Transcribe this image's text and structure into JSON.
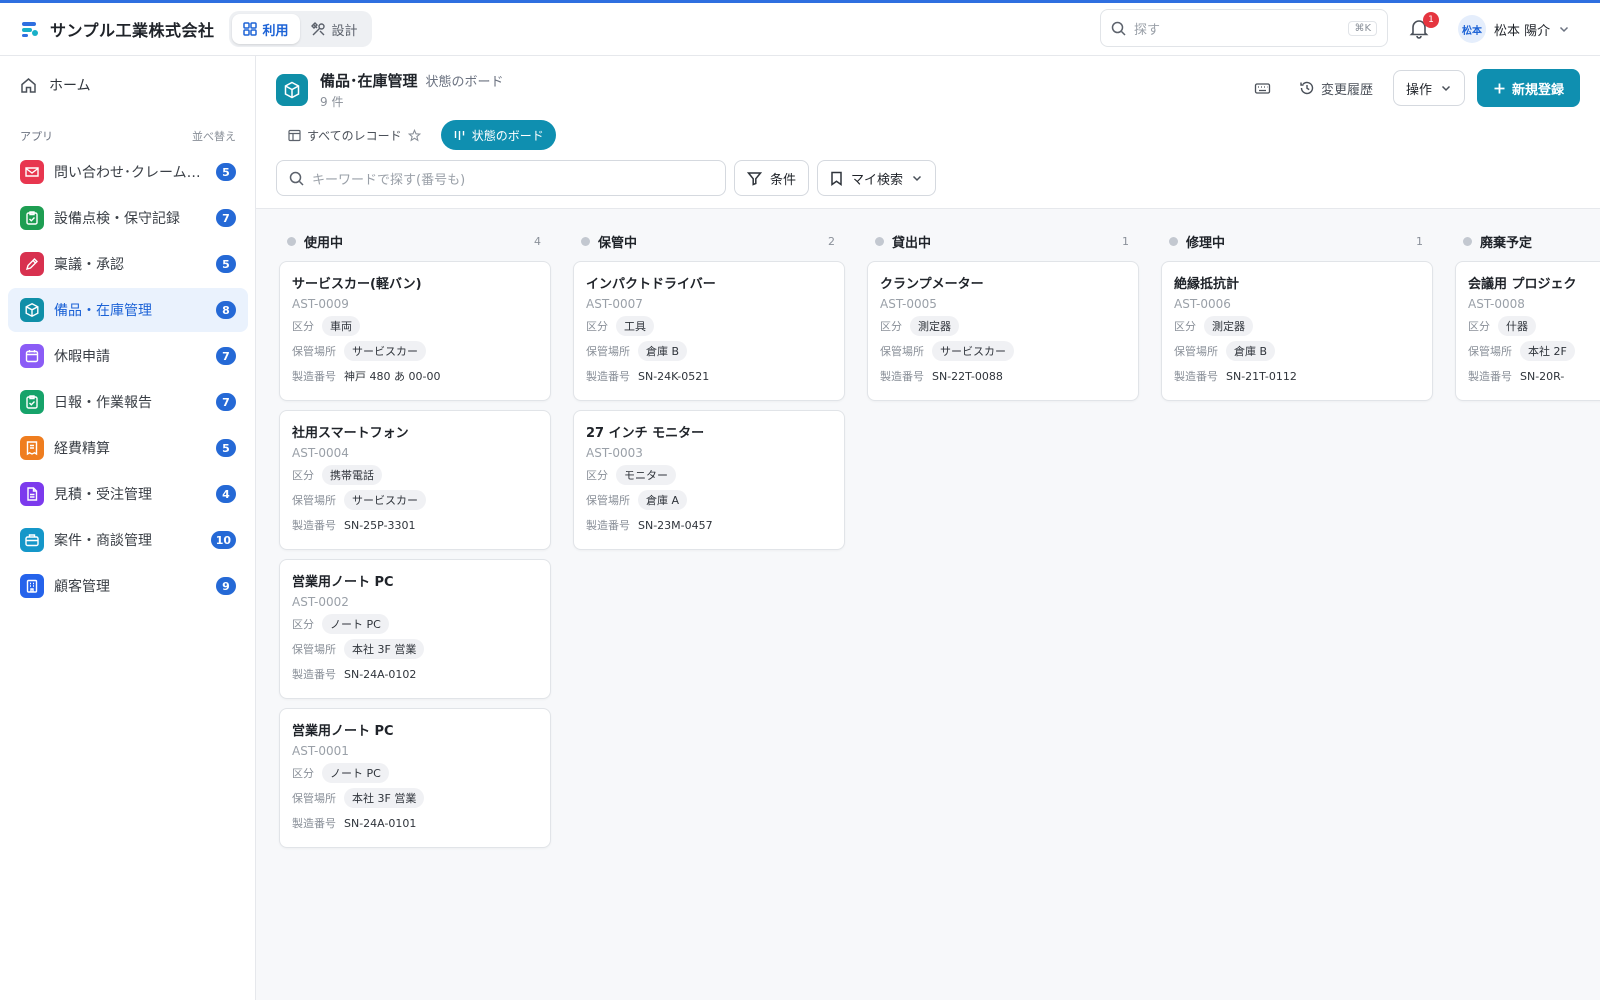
{
  "header": {
    "company": "サンプル工業株式会社",
    "modes": [
      {
        "label": "利用",
        "active": true
      },
      {
        "label": "設計",
        "active": false
      }
    ],
    "search_placeholder": "探す",
    "shortcut": "⌘K",
    "notification_count": "1",
    "user_avatar": "松本",
    "user_name": "松本 陽介"
  },
  "sidebar": {
    "home": "ホーム",
    "apps_label": "アプリ",
    "sort_label": "並べ替え",
    "apps": [
      {
        "label": "問い合わせ･クレーム管理",
        "count": "5",
        "color": "#e8364f",
        "icon": "mail"
      },
      {
        "label": "設備点検・保守記録",
        "count": "7",
        "color": "#1e9e52",
        "icon": "clipboard"
      },
      {
        "label": "稟議・承認",
        "count": "5",
        "color": "#d8314f",
        "icon": "pen"
      },
      {
        "label": "備品・在庫管理",
        "count": "8",
        "color": "#0f8fa8",
        "icon": "box",
        "active": true
      },
      {
        "label": "休暇申請",
        "count": "7",
        "color": "#8b5cf6",
        "icon": "calendar"
      },
      {
        "label": "日報・作業報告",
        "count": "7",
        "color": "#16a36a",
        "icon": "clipboard"
      },
      {
        "label": "経費精算",
        "count": "5",
        "color": "#ef7d1f",
        "icon": "receipt"
      },
      {
        "label": "見積・受注管理",
        "count": "4",
        "color": "#7c3aed",
        "icon": "document"
      },
      {
        "label": "案件・商談管理",
        "count": "10",
        "color": "#1597c9",
        "icon": "briefcase"
      },
      {
        "label": "顧客管理",
        "count": "9",
        "color": "#2563eb",
        "icon": "building"
      }
    ]
  },
  "page": {
    "title": "備品･在庫管理",
    "subtitle": "状態のボード",
    "count": "9 件",
    "history_label": "変更履歴",
    "ops_label": "操作",
    "new_label": "新規登録",
    "tabs": [
      {
        "label": "すべてのレコード"
      },
      {
        "label": "状態のボード"
      }
    ],
    "keyword_placeholder": "キーワードで探す(番号も)",
    "filter_label": "条件",
    "saved_search_label": "マイ検索"
  },
  "fields": {
    "category": "区分",
    "location": "保管場所",
    "serial": "製造番号"
  },
  "board": {
    "columns": [
      {
        "name": "使用中",
        "count": "4",
        "cards": [
          {
            "title": "サービスカー(軽バン)",
            "id": "AST-0009",
            "category": "車両",
            "location": "サービスカー",
            "serial": "神戸 480 あ 00-00"
          },
          {
            "title": "社用スマートフォン",
            "id": "AST-0004",
            "category": "携帯電話",
            "location": "サービスカー",
            "serial": "SN-25P-3301"
          },
          {
            "title": "営業用ノート PC",
            "id": "AST-0002",
            "category": "ノート PC",
            "location": "本社 3F 営業",
            "serial": "SN-24A-0102"
          },
          {
            "title": "営業用ノート PC",
            "id": "AST-0001",
            "category": "ノート PC",
            "location": "本社 3F 営業",
            "serial": "SN-24A-0101"
          }
        ]
      },
      {
        "name": "保管中",
        "count": "2",
        "cards": [
          {
            "title": "インパクトドライバー",
            "id": "AST-0007",
            "category": "工具",
            "location": "倉庫 B",
            "serial": "SN-24K-0521"
          },
          {
            "title": "27 インチ モニター",
            "id": "AST-0003",
            "category": "モニター",
            "location": "倉庫 A",
            "serial": "SN-23M-0457"
          }
        ]
      },
      {
        "name": "貸出中",
        "count": "1",
        "cards": [
          {
            "title": "クランプメーター",
            "id": "AST-0005",
            "category": "測定器",
            "location": "サービスカー",
            "serial": "SN-22T-0088"
          }
        ]
      },
      {
        "name": "修理中",
        "count": "1",
        "cards": [
          {
            "title": "絶縁抵抗計",
            "id": "AST-0006",
            "category": "測定器",
            "location": "倉庫 B",
            "serial": "SN-21T-0112"
          }
        ]
      },
      {
        "name": "廃棄予定",
        "count": "",
        "cards": [
          {
            "title": "会議用 プロジェク",
            "id": "AST-0008",
            "category": "什器",
            "location": "本社 2F",
            "serial": "SN-20R-"
          }
        ]
      }
    ]
  }
}
